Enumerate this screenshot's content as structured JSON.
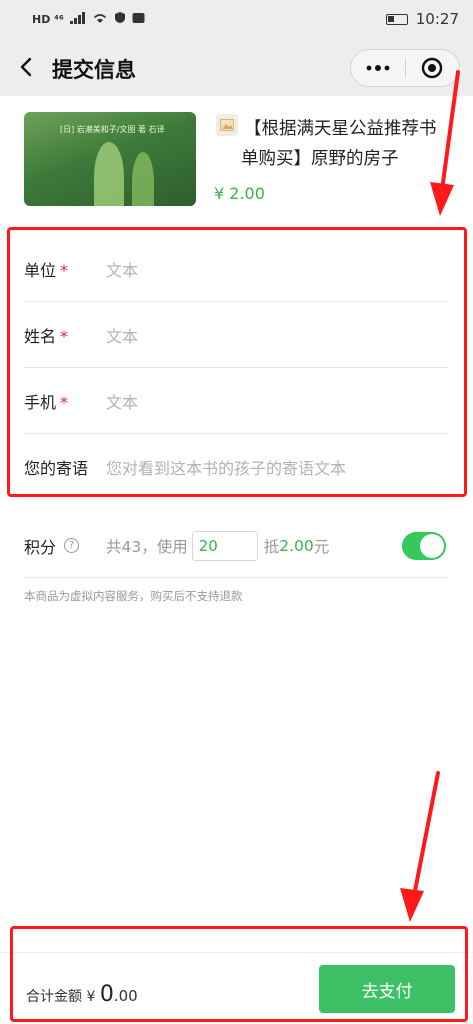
{
  "status_bar": {
    "left_indicators": "HD ⁴⁶",
    "time": "10:27"
  },
  "nav": {
    "title": "提交信息"
  },
  "product": {
    "cover_text": "[日] 岩濑美和子/文图  著  石译",
    "title_line1": "【根据满天星公益推荐书",
    "title_line2": "单购买】原野的房子",
    "price": "¥ 2.00"
  },
  "form": {
    "fields": [
      {
        "label": "单位",
        "required": "*",
        "placeholder": "文本"
      },
      {
        "label": "姓名",
        "required": "*",
        "placeholder": "文本"
      },
      {
        "label": "手机",
        "required": "*",
        "placeholder": "文本"
      },
      {
        "label": "您的寄语",
        "required": "",
        "placeholder": "您对看到这本书的孩子的寄语文本"
      }
    ]
  },
  "points": {
    "label": "积分",
    "help": "?",
    "total_text": "共43，使用",
    "use_value": "20",
    "deduct_prefix": "抵",
    "deduct_amount": "2.00",
    "deduct_suffix": "元",
    "enabled": true
  },
  "notice": "本商品为虚拟内容服务，购买后不支持退款",
  "footer": {
    "total_label": "合计金额",
    "currency": "¥",
    "amount_int": "0",
    "amount_dec": ".00",
    "pay_label": "去支付"
  },
  "colors": {
    "accent_green": "#3cb24b",
    "pay_button": "#3ec066",
    "annotation_red": "#ff1a1a",
    "required_star": "#e02e2e"
  }
}
